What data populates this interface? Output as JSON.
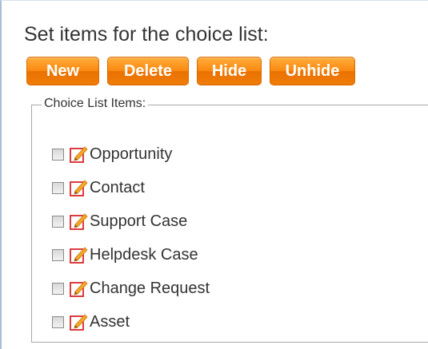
{
  "heading": "Set items for the choice list:",
  "toolbar": {
    "new_label": "New",
    "delete_label": "Delete",
    "hide_label": "Hide",
    "unhide_label": "Unhide"
  },
  "choice_list": {
    "legend": "Choice List Items:",
    "items": [
      {
        "label": "Opportunity",
        "checked": false,
        "icon": "edit-icon"
      },
      {
        "label": "Contact",
        "checked": false,
        "icon": "edit-icon"
      },
      {
        "label": "Support Case",
        "checked": false,
        "icon": "edit-icon"
      },
      {
        "label": "Helpdesk Case",
        "checked": false,
        "icon": "edit-icon"
      },
      {
        "label": "Change Request",
        "checked": false,
        "icon": "edit-icon"
      },
      {
        "label": "Asset",
        "checked": false,
        "icon": "edit-icon"
      }
    ]
  },
  "colors": {
    "button_orange": "#f57f0a",
    "button_text": "#ffffff",
    "edit_icon_frame": "#d9262b",
    "edit_icon_pencil": "#f5a623",
    "panel_border": "#a9bdd6"
  }
}
